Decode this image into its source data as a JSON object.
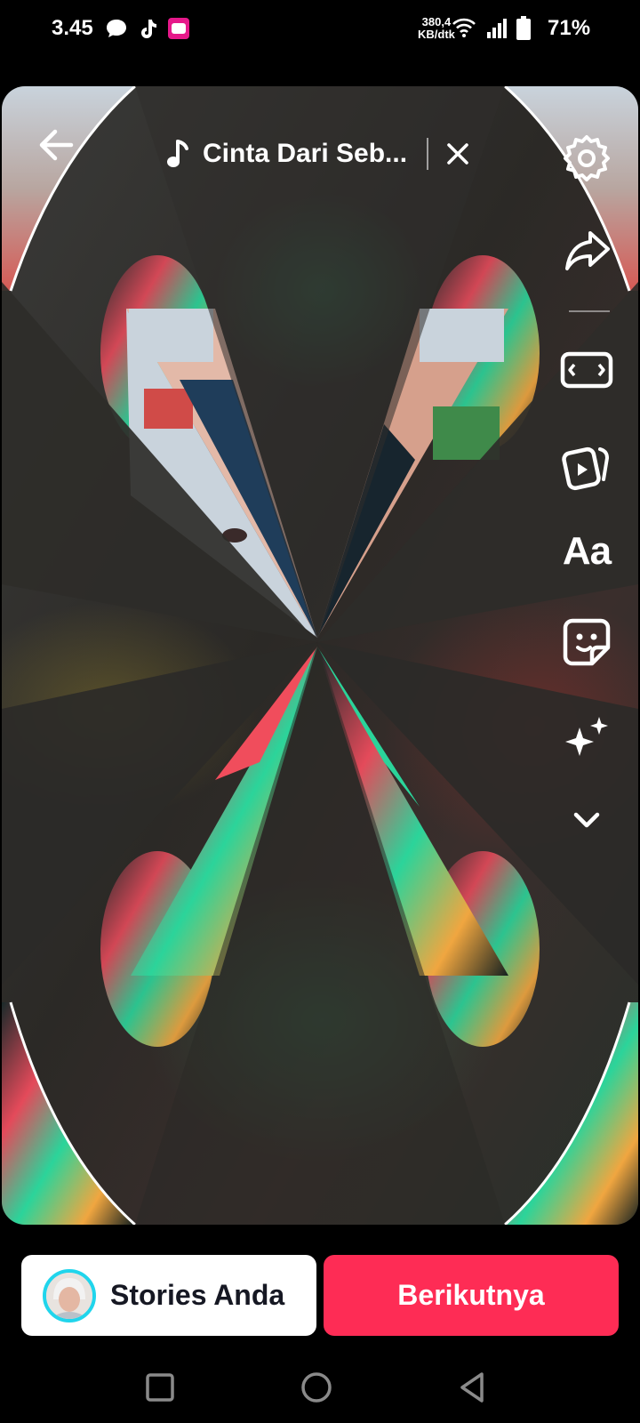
{
  "status_bar": {
    "time": "3.45",
    "icons": [
      "message-icon",
      "tiktok-icon",
      "lazada-icon",
      "wifi-icon",
      "signal-icon",
      "battery-icon"
    ],
    "net_speed_value": "380,4",
    "net_speed_unit": "KB/dtk",
    "battery": "71%"
  },
  "header": {
    "music_title": "Cinta Dari Seb...",
    "back_icon": "back-arrow-icon",
    "close_icon": "close-icon"
  },
  "toolbar": {
    "items": [
      "settings-icon",
      "share-icon",
      "resize-icon",
      "template-icon",
      "text-tool",
      "sticker-icon",
      "effects-icon",
      "more-chevron-icon"
    ],
    "text_tool_label": "Aa"
  },
  "footer": {
    "stories_label": "Stories Anda",
    "next_label": "Berikutnya"
  },
  "colors": {
    "accent": "#fe2c55",
    "avatar_ring": "#20d5ec",
    "background": "#000000"
  },
  "nav": {
    "items": [
      "recent-apps-icon",
      "home-icon",
      "back-icon"
    ]
  }
}
